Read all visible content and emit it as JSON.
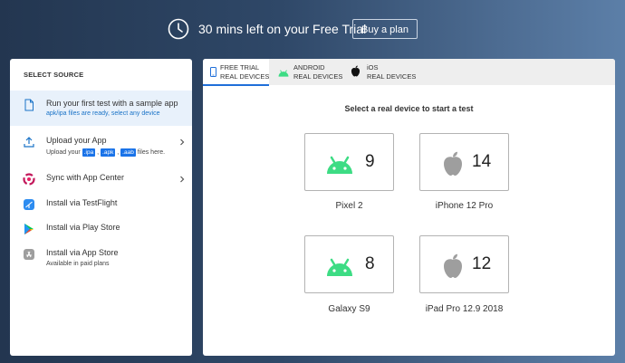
{
  "banner": {
    "trial_text": "30 mins left on your Free Trial",
    "buy_label": "Buy a plan"
  },
  "source_panel": {
    "title": "SELECT SOURCE",
    "sample": {
      "label": "Run your first test with a sample app",
      "sub": "apk/ipa files are ready, select any device"
    },
    "upload": {
      "label": "Upload your App",
      "sub_pre": "Upload your",
      "ipa": ".ipa",
      "apk": ".apk",
      "aab": ".aab",
      "sub_post": "files here."
    },
    "appcenter": {
      "label": "Sync with App Center"
    },
    "testflight": {
      "label": "Install via TestFlight"
    },
    "playstore": {
      "label": "Install via Play Store"
    },
    "appstore": {
      "label": "Install via App Store",
      "sub": "Available in paid plans"
    }
  },
  "tabs": [
    {
      "line1": "FREE TRIAL",
      "line2": "REAL DEVICES",
      "active": true
    },
    {
      "line1": "ANDROID",
      "line2": "REAL DEVICES",
      "active": false
    },
    {
      "line1": "iOS",
      "line2": "REAL DEVICES",
      "active": false
    }
  ],
  "prompt": "Select a real device to start a test",
  "devices": [
    {
      "name": "Pixel 2",
      "version": "9",
      "os": "android"
    },
    {
      "name": "iPhone 12 Pro",
      "version": "14",
      "os": "ios"
    },
    {
      "name": "Galaxy S9",
      "version": "8",
      "os": "android"
    },
    {
      "name": "iPad Pro 12.9 2018",
      "version": "12",
      "os": "ios"
    }
  ],
  "colors": {
    "android": "#3ddc84",
    "apple": "#9e9e9e",
    "accent": "#1f6fd9"
  }
}
